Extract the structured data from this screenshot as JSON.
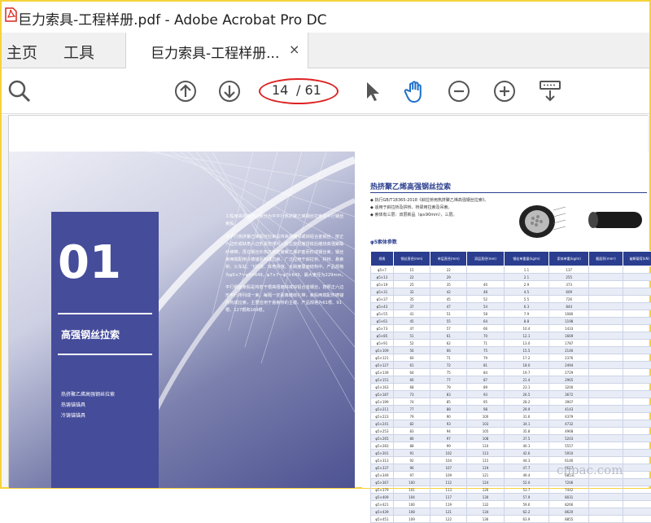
{
  "window": {
    "title": "巨力索具-工程样册.pdf - Adobe Acrobat Pro DC",
    "icon": "acrobat-icon"
  },
  "tabs": {
    "home": "主页",
    "tools": "工具",
    "document": "巨力索具-工程样册...",
    "close": "×"
  },
  "toolbar": {
    "search_icon": "search-icon",
    "page_current": "14",
    "page_total": "/ 61",
    "accent_color": "#d22222"
  },
  "page": {
    "left": {
      "section_number": "01",
      "section_title": "高强钢丝拉索",
      "side_items": [
        "热挤聚乙烯高强钢丝拉索",
        "热铸锚锚具",
        "冷铸锚锚具"
      ],
      "paragraphs": [
        "工程用高强钢丝拉索分为平平行热挤聚乙烯钢丝拉索及平行钢丝索股。",
        "平平行热挤聚乙烯钢丝拉索是将高强镀锌或锌铝合金钢丝，按正六边形或缺角六边形紧密排列，经左旋轻度扭绞后缠绕高强聚酯纤维带，再在钢丝外热挤高密度聚乙烯护套而形成钢丝束，钢丝束两端配用冷铸锚而构成拉索，广泛应用于斜拉桥、拱桥、悬索桥、火车站、飞机场、体育场馆、大跨度屋面结构中。产品规格为φ5×7～φ5×649，φ7×7～φ7×649，最大索径为229mm。",
        "平行钢丝索股是将若干根高强镀锌或锌铝合金钢丝，按照正六边形平行排列成一束，每隔一定距离缠绕扎带，索股两端配热铸锚而构成拉索，主要应用于悬索桥的主缆。产品规格为61根、91根、127根和169根。"
      ],
      "bg_color": "#454c9a"
    },
    "right": {
      "title": "热挤聚乙烯高强钢丝拉索",
      "bullets": [
        "执行GB/T18365-2018《斜拉桥用热挤聚乙烯高强钢丝拉索》。",
        "适用于斜拉桥及拱桥、桥梁用拉索及吊索。",
        "索体有三层：双层新品（φ≥90mm），三层。"
      ],
      "subtitle": "φ5索体参数",
      "table": {
        "headers": [
          "规格",
          "钢丝直径(mm)",
          "单层直径(mm)",
          "双层直径(mm)",
          "钢丝单重量(kg/m)",
          "索体单重(kg/m)",
          "截面积(mm²)",
          "破断载荷(kN)"
        ],
        "rows": [
          [
            "φ5×7",
            "15",
            "22",
            "",
            "1.1",
            "137"
          ],
          [
            "φ5×13",
            "22",
            "29",
            "",
            "2.1",
            "255"
          ],
          [
            "φ5×19",
            "25",
            "35",
            "40",
            "2.9",
            "373"
          ],
          [
            "φ5×31",
            "32",
            "42",
            "48",
            "4.5",
            "609"
          ],
          [
            "φ5×37",
            "35",
            "45",
            "52",
            "5.5",
            "726"
          ],
          [
            "φ5×43",
            "37",
            "47",
            "54",
            "6.3",
            "844"
          ],
          [
            "φ5×55",
            "41",
            "51",
            "58",
            "7.9",
            "1080"
          ],
          [
            "φ5×61",
            "45",
            "55",
            "64",
            "8.8",
            "1198"
          ],
          [
            "φ5×73",
            "47",
            "57",
            "66",
            "10.4",
            "1433"
          ],
          [
            "φ5×85",
            "51",
            "61",
            "70",
            "12.1",
            "1669"
          ],
          [
            "φ5×91",
            "52",
            "62",
            "71",
            "13.0",
            "1787"
          ],
          [
            "φ5×109",
            "56",
            "66",
            "75",
            "15.5",
            "2140"
          ],
          [
            "φ5×121",
            "60",
            "71",
            "79",
            "17.2",
            "2376"
          ],
          [
            "φ5×127",
            "61",
            "72",
            "81",
            "18.0",
            "2494"
          ],
          [
            "φ5×139",
            "64",
            "75",
            "84",
            "19.7",
            "2729"
          ],
          [
            "φ5×151",
            "66",
            "77",
            "87",
            "21.4",
            "2965"
          ],
          [
            "φ5×163",
            "68",
            "79",
            "89",
            "23.1",
            "3200"
          ],
          [
            "φ5×187",
            "73",
            "83",
            "93",
            "26.5",
            "3672"
          ],
          [
            "φ5×199",
            "74",
            "85",
            "95",
            "28.2",
            "3907"
          ],
          [
            "φ5×211",
            "77",
            "88",
            "98",
            "29.9",
            "4143"
          ],
          [
            "φ5×223",
            "79",
            "90",
            "100",
            "31.6",
            "4379"
          ],
          [
            "φ5×241",
            "82",
            "93",
            "103",
            "34.1",
            "4732"
          ],
          [
            "φ5×253",
            "83",
            "94",
            "105",
            "35.8",
            "4968"
          ],
          [
            "φ5×265",
            "86",
            "97",
            "108",
            "37.5",
            "5203"
          ],
          [
            "φ5×283",
            "88",
            "99",
            "110",
            "40.1",
            "5557"
          ],
          [
            "φ5×301",
            "91",
            "102",
            "113",
            "42.6",
            "5910"
          ],
          [
            "φ5×313",
            "92",
            "104",
            "115",
            "44.3",
            "6146"
          ],
          [
            "φ5×337",
            "96",
            "107",
            "119",
            "47.7",
            "6617"
          ],
          [
            "φ5×349",
            "97",
            "109",
            "121",
            "49.4",
            "6853"
          ],
          [
            "φ5×367",
            "100",
            "112",
            "124",
            "52.0",
            "7206"
          ],
          [
            "φ5×379",
            "101",
            "113",
            "126",
            "53.7",
            "7442"
          ],
          [
            "φ5×409",
            "104",
            "117",
            "130",
            "57.9",
            "8031"
          ],
          [
            "φ5×421",
            "106",
            "119",
            "132",
            "59.6",
            "8266"
          ],
          [
            "φ5×439",
            "108",
            "121",
            "134",
            "62.2",
            "8620"
          ],
          [
            "φ5×451",
            "109",
            "122",
            "136",
            "63.9",
            "8855"
          ]
        ]
      }
    }
  },
  "watermark": "cnpac.com"
}
